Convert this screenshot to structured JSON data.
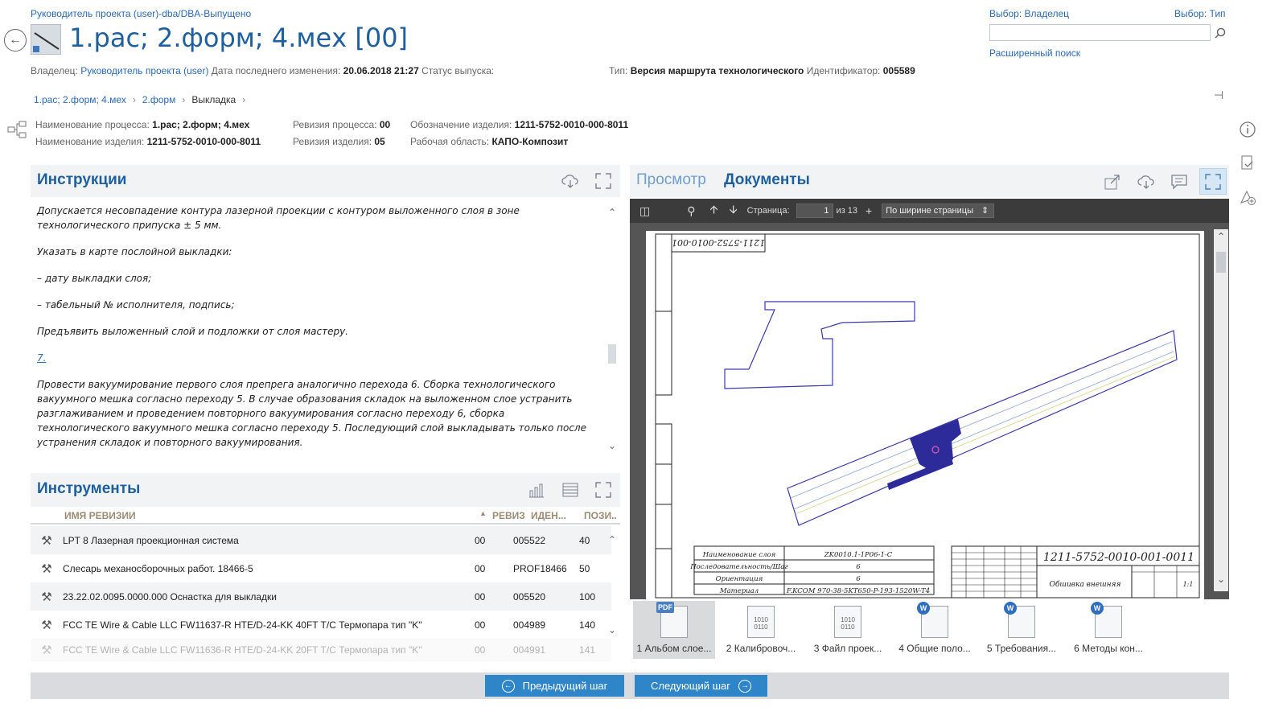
{
  "header": {
    "top_breadcrumb": "Руководитель проекта (user)-dba/DBA-Выпущено",
    "title": "1.рас; 2.форм; 4.мех [00]",
    "owner_label": "Владелец:",
    "owner_value": "Руководитель проекта (user)",
    "modified_label": "Дата последнего изменения:",
    "modified_value": "20.06.2018 21:27",
    "release_label": "Статус выпуска:",
    "type_label": "Тип:",
    "type_value": "Версия маршрута технологического",
    "id_label": "Идентификатор:",
    "id_value": "005589"
  },
  "search": {
    "select_owner": "Выбор: Владелец",
    "select_type": "Выбор: Тип",
    "placeholder": "",
    "advanced": "Расширенный поиск"
  },
  "breadcrumb": [
    "1.рас; 2.форм; 4.мех",
    "2.форм",
    "Выкладка"
  ],
  "info": {
    "process_name_label": "Наименование процесса:",
    "process_name": "1.рас; 2.форм; 4.мех",
    "process_rev_label": "Ревизия процесса:",
    "process_rev": "00",
    "product_code_label": "Обозначение изделия:",
    "product_code": "1211-5752-0010-000-8011",
    "product_name_label": "Наименование изделия:",
    "product_name": "1211-5752-0010-000-8011",
    "product_rev_label": "Ревизия изделия:",
    "product_rev": "05",
    "workspace_label": "Рабочая область:",
    "workspace": "КАПО-Композит"
  },
  "instructions": {
    "title": "Инструкции",
    "p1": "Допускается несовпадение контура лазерной проекции с контуром выложенного слоя в зоне технологического припуска ± 5 мм.",
    "p2": "Указать в карте послойной выкладки:",
    "p3": "– дату выкладки слоя;",
    "p4": "– табельный № исполнителя, подпись;",
    "p5": "Предъявить выложенный слой и подложки от слоя мастеру.",
    "step": "7.",
    "p6": "Провести вакуумирование первого слоя препрега аналогично перехода 6. Сборка технологического вакуумного мешка согласно переходу 5. В случае образования складок на выложенном слое устранить разглаживанием и проведением повторного вакуумирования согласно переходу 6, сборка технологического вакуумного мешка согласно переходу 5. Последующий слой выкладывать только после устранения складок и повторного вакуумирования."
  },
  "tools": {
    "title": "Инструменты",
    "columns": {
      "name": "ИМЯ РЕВИЗИИ",
      "rev": "РЕВИЗ",
      "id": "ИДЕН...",
      "pos": "ПОЗИ.."
    },
    "rows": [
      {
        "name": "LPT 8 Лазерная проекционная система",
        "rev": "00",
        "id": "005522",
        "pos": "40"
      },
      {
        "name": "Слесарь механосборочных работ. 18466-5",
        "rev": "00",
        "id": "PROF18466",
        "pos": "50"
      },
      {
        "name": "23.22.02.0095.0000.000 Оснастка для выкладки",
        "rev": "00",
        "id": "005520",
        "pos": "100"
      },
      {
        "name": "FCC TE Wire & Cable LLC FW11637-R HTE/D-24-KK 40FT T/C Термопара тип \"K\"",
        "rev": "00",
        "id": "004989",
        "pos": "140"
      },
      {
        "name": "FCC TE Wire & Cable LLC FW11636-R HTE/D-24-KK 20FT T/C Термопара тип \"K\"",
        "rev": "00",
        "id": "004991",
        "pos": "141"
      }
    ]
  },
  "viewer": {
    "tab_preview": "Просмотр",
    "tab_docs": "Документы",
    "page_label": "Страница:",
    "page_value": "1",
    "page_of": "из 13",
    "zoom": "По ширине страницы",
    "drawing_code": "1211-5752-0010-001-0011",
    "drawing_code_flipped": "1211-5752-0010-001",
    "table_rows": [
      {
        "label": "Наименование слоя",
        "value": "ZK0010.1-1P06-1-C"
      },
      {
        "label": "Последовательность/Шаг",
        "value": "6"
      },
      {
        "label": "Ориентация",
        "value": "6"
      },
      {
        "label": "Материал",
        "value": "F.KCOM 970-38-5KT650-P-193-1520W-T4"
      }
    ],
    "stamp_note": "Обшивка внешняя",
    "stamp_scale": "1:1"
  },
  "documents": [
    {
      "label": "1 Альбом слое...",
      "badge": "PDF",
      "kind": "pdf"
    },
    {
      "label": "2 Калибровоч...",
      "badge": "",
      "kind": "bin"
    },
    {
      "label": "3 Файл проек...",
      "badge": "",
      "kind": "bin"
    },
    {
      "label": "4 Общие поло...",
      "badge": "W",
      "kind": "word"
    },
    {
      "label": "5 Требования...",
      "badge": "W",
      "kind": "word"
    },
    {
      "label": "6 Методы кон...",
      "badge": "W",
      "kind": "word"
    }
  ],
  "footer": {
    "prev": "Предыдущий шаг",
    "next": "Следующий шаг"
  },
  "colors": {
    "accent": "#1e5f9f",
    "link": "#2a6ab5",
    "button": "#2e86c8",
    "drawing_fill": "#2d2a9a"
  }
}
